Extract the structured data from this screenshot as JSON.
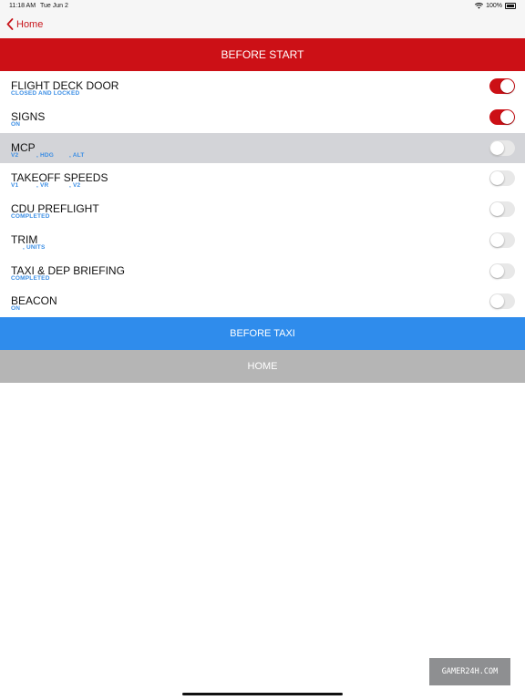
{
  "status": {
    "time": "11:18 AM",
    "date": "Tue Jun 2",
    "battery": "100%"
  },
  "nav": {
    "back_label": "Home"
  },
  "header": {
    "title": "BEFORE START"
  },
  "items": [
    {
      "title": "FLIGHT DECK DOOR",
      "subs": [
        "CLOSED AND LOCKED"
      ],
      "on": true
    },
    {
      "title": "SIGNS",
      "subs": [
        "ON"
      ],
      "on": true
    },
    {
      "title": "MCP",
      "subs": [
        "V2",
        ", HDG",
        ", ALT"
      ],
      "on": false,
      "highlighted": true
    },
    {
      "title": "TAKEOFF SPEEDS",
      "subs": [
        "V1",
        ", VR",
        ", V2"
      ],
      "on": false
    },
    {
      "title": "CDU PREFLIGHT",
      "subs": [
        "COMPLETED"
      ],
      "on": false
    },
    {
      "title": "TRIM",
      "subs": [
        ", UNITS"
      ],
      "on": false
    },
    {
      "title": "TAXI & DEP BRIEFING",
      "subs": [
        "COMPLETED"
      ],
      "on": false
    },
    {
      "title": "BEACON",
      "subs": [
        "ON"
      ],
      "on": false
    }
  ],
  "buttons": {
    "next": "BEFORE TAXI",
    "home": "HOME"
  },
  "watermark": "GAMER24H.COM",
  "colors": {
    "accent": "#cc1016",
    "link_blue": "#2f8cec",
    "home_gray": "#b5b5b5"
  }
}
